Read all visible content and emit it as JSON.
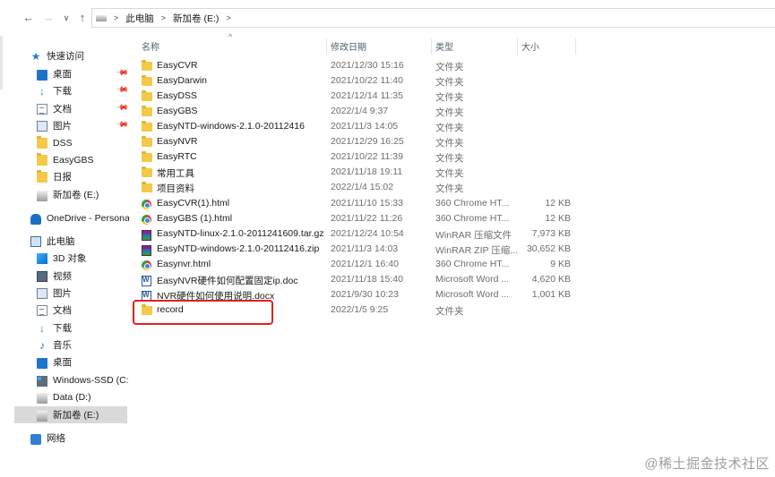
{
  "breadcrumb": [
    "此电脑",
    "新加卷 (E:)"
  ],
  "columns": {
    "name": "名称",
    "modified": "修改日期",
    "type": "类型",
    "size": "大小"
  },
  "sidebar": {
    "quick_access": "快速访问",
    "quick_items": [
      {
        "label": "桌面",
        "icon": "desktop-icon",
        "pinned": true
      },
      {
        "label": "下载",
        "icon": "download-icon",
        "pinned": true
      },
      {
        "label": "文档",
        "icon": "document-icon",
        "pinned": true
      },
      {
        "label": "图片",
        "icon": "pictures-icon",
        "pinned": true
      },
      {
        "label": "DSS",
        "icon": "folder-icon",
        "pinned": false
      },
      {
        "label": "EasyGBS",
        "icon": "folder-icon",
        "pinned": false
      },
      {
        "label": "日报",
        "icon": "folder-icon",
        "pinned": false
      },
      {
        "label": "新加卷 (E:)",
        "icon": "drive-icon",
        "pinned": false
      }
    ],
    "onedrive": "OneDrive - Persona",
    "this_pc": "此电脑",
    "pc_items": [
      {
        "label": "3D 对象",
        "icon": "3d-objects-icon"
      },
      {
        "label": "视频",
        "icon": "videos-icon"
      },
      {
        "label": "图片",
        "icon": "pictures-icon"
      },
      {
        "label": "文档",
        "icon": "document-icon"
      },
      {
        "label": "下载",
        "icon": "download-icon"
      },
      {
        "label": "音乐",
        "icon": "music-icon"
      },
      {
        "label": "桌面",
        "icon": "desktop-icon"
      },
      {
        "label": "Windows-SSD (C:)",
        "icon": "windows-drive-icon"
      },
      {
        "label": "Data (D:)",
        "icon": "drive-icon"
      },
      {
        "label": "新加卷 (E:)",
        "icon": "drive-icon",
        "selected": true
      }
    ],
    "network": "网络"
  },
  "files": [
    {
      "name": "EasyCVR",
      "date": "2021/12/30 15:16",
      "type": "文件夹",
      "size": "",
      "icon": "folder-icon"
    },
    {
      "name": "EasyDarwin",
      "date": "2021/10/22 11:40",
      "type": "文件夹",
      "size": "",
      "icon": "folder-icon"
    },
    {
      "name": "EasyDSS",
      "date": "2021/12/14 11:35",
      "type": "文件夹",
      "size": "",
      "icon": "folder-icon"
    },
    {
      "name": "EasyGBS",
      "date": "2022/1/4 9:37",
      "type": "文件夹",
      "size": "",
      "icon": "folder-icon"
    },
    {
      "name": "EasyNTD-windows-2.1.0-20112416",
      "date": "2021/11/3 14:05",
      "type": "文件夹",
      "size": "",
      "icon": "folder-icon"
    },
    {
      "name": "EasyNVR",
      "date": "2021/12/29 16:25",
      "type": "文件夹",
      "size": "",
      "icon": "folder-icon"
    },
    {
      "name": "EasyRTC",
      "date": "2021/10/22 11:39",
      "type": "文件夹",
      "size": "",
      "icon": "folder-icon"
    },
    {
      "name": "常用工具",
      "date": "2021/11/18 19:11",
      "type": "文件夹",
      "size": "",
      "icon": "folder-icon"
    },
    {
      "name": "项目资料",
      "date": "2022/1/4 15:02",
      "type": "文件夹",
      "size": "",
      "icon": "folder-icon"
    },
    {
      "name": "EasyCVR(1).html",
      "date": "2021/11/10 15:33",
      "type": "360 Chrome HT...",
      "size": "12 KB",
      "icon": "chrome-icon"
    },
    {
      "name": "EasyGBS (1).html",
      "date": "2021/11/22 11:26",
      "type": "360 Chrome HT...",
      "size": "12 KB",
      "icon": "chrome-icon"
    },
    {
      "name": "EasyNTD-linux-2.1.0-2011241609.tar.gz",
      "date": "2021/12/24 10:54",
      "type": "WinRAR 压缩文件",
      "size": "7,973 KB",
      "icon": "winrar-icon"
    },
    {
      "name": "EasyNTD-windows-2.1.0-20112416.zip",
      "date": "2021/11/3 14:03",
      "type": "WinRAR ZIP 压缩...",
      "size": "30,652 KB",
      "icon": "winrar-icon"
    },
    {
      "name": "Easynvr.html",
      "date": "2021/12/1 16:40",
      "type": "360 Chrome HT...",
      "size": "9 KB",
      "icon": "chrome-icon"
    },
    {
      "name": "EasyNVR硬件如何配置固定ip.doc",
      "date": "2021/11/18 15:40",
      "type": "Microsoft Word ...",
      "size": "4,620 KB",
      "icon": "word-icon"
    },
    {
      "name": "NVR硬件如何使用说明.docx",
      "date": "2021/9/30 10:23",
      "type": "Microsoft Word ...",
      "size": "1,001 KB",
      "icon": "word-icon"
    },
    {
      "name": "record",
      "date": "2022/1/5 9:25",
      "type": "文件夹",
      "size": "",
      "icon": "folder-icon"
    }
  ],
  "highlight_color": "#e02020",
  "watermark": "@稀土掘金技术社区"
}
